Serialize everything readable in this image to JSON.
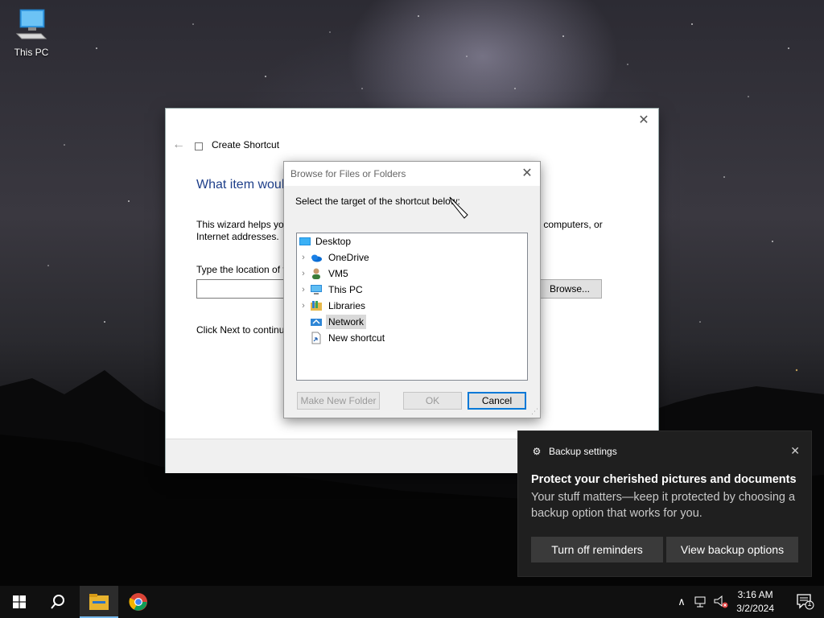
{
  "desktop": {
    "icon_label": "This PC"
  },
  "wizard": {
    "title": "Create Shortcut",
    "heading": "What item woul",
    "desc_left": "This wizard helps yo",
    "desc_right": "ers, computers, or",
    "desc_line2": "Internet addresses.",
    "location_label": "Type the location of t",
    "location_value": "",
    "browse_label": "Browse...",
    "next_text": "Click Next to continu"
  },
  "browse_dialog": {
    "title": "Browse for Files or Folders",
    "prompt": "Select the target of the shortcut below:",
    "tree": [
      {
        "label": "Desktop",
        "icon": "desktop-icon",
        "expandable": false,
        "selected": false
      },
      {
        "label": "OneDrive",
        "icon": "onedrive-icon",
        "expandable": true,
        "selected": false
      },
      {
        "label": "VM5",
        "icon": "user-icon",
        "expandable": true,
        "selected": false
      },
      {
        "label": "This PC",
        "icon": "computer-icon",
        "expandable": true,
        "selected": false
      },
      {
        "label": "Libraries",
        "icon": "libraries-icon",
        "expandable": true,
        "selected": false
      },
      {
        "label": "Network",
        "icon": "network-icon",
        "expandable": false,
        "selected": true
      },
      {
        "label": "New shortcut",
        "icon": "shortcut-file-icon",
        "expandable": false,
        "selected": false
      }
    ],
    "make_folder_label": "Make New Folder",
    "ok_label": "OK",
    "cancel_label": "Cancel"
  },
  "toast": {
    "app_name": "Backup settings",
    "headline": "Protect your cherished pictures and documents",
    "body": "Your stuff matters—keep it protected by choosing a backup option that works for you.",
    "btn_turn_off": "Turn off reminders",
    "btn_view": "View backup options"
  },
  "taskbar": {
    "time": "3:16 AM",
    "date": "3/2/2024",
    "notification_count": "1"
  },
  "colors": {
    "accent": "#0078d7",
    "heading_blue": "#1e3f8a",
    "toast_bg": "#1f1f1f"
  }
}
